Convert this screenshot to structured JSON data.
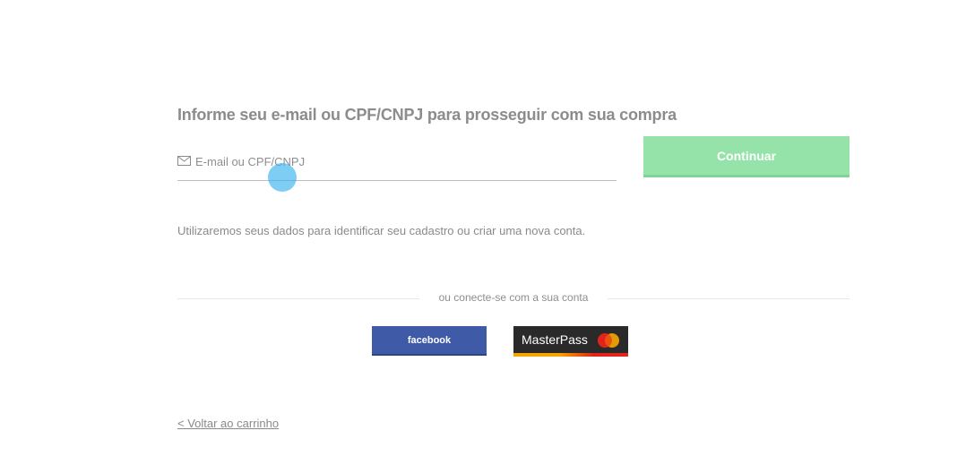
{
  "login": {
    "heading": "Informe seu e-mail ou CPF/CNPJ para prosseguir com sua compra",
    "email_placeholder": "E-mail ou CPF/CNPJ",
    "email_value": "",
    "continue_label": "Continuar",
    "info_text": "Utilizaremos seus dados para identificar seu cadastro ou criar uma nova conta."
  },
  "social": {
    "divider_text": "ou conecte-se com a sua conta",
    "facebook_label": "facebook",
    "masterpass_label": "MasterPass"
  },
  "footer": {
    "back_link": "< Voltar ao carrinho"
  },
  "colors": {
    "continue_bg": "#95e3a8",
    "facebook_bg": "#3f5ba8",
    "masterpass_bg": "#2a2a2a",
    "cursor_dot": "#38b2f0"
  },
  "icons": {
    "email_field_icon": "envelope-icon",
    "masterpass_logo": "mastercard-logo-icon"
  }
}
